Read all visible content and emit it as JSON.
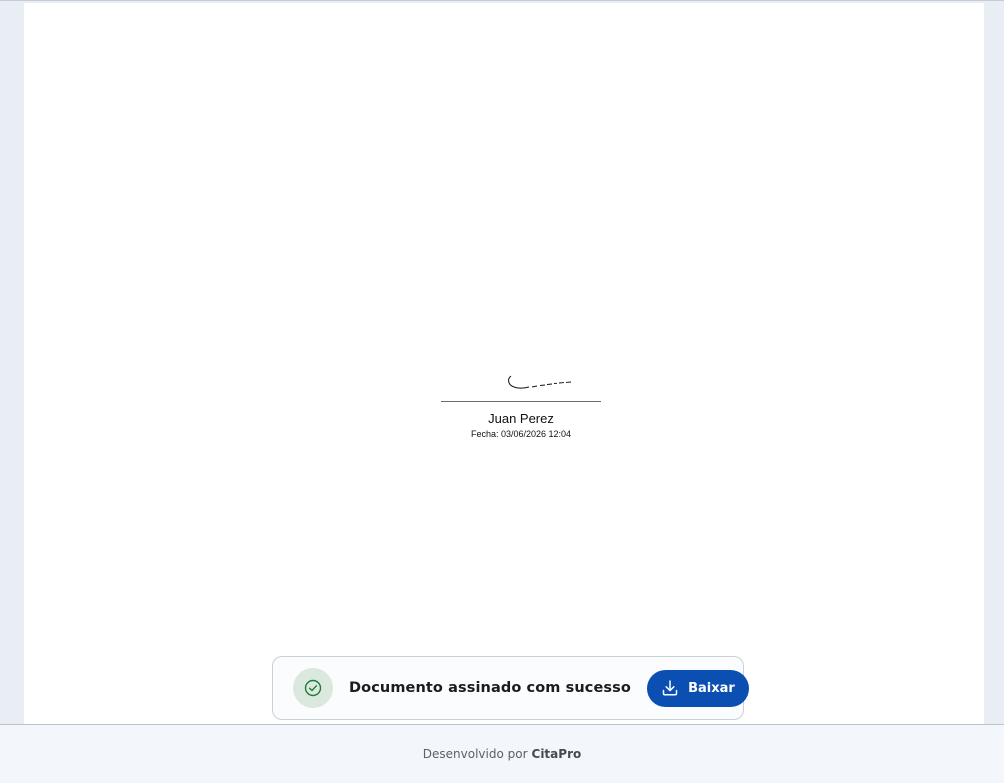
{
  "document": {
    "signature": {
      "image_kind": "handwritten-signature",
      "signer_name": "Juan Perez",
      "date_line": "Fecha: 03/06/2026 12:04"
    }
  },
  "toast": {
    "icon": "check-circle-icon",
    "message": "Documento assinado com sucesso",
    "download_button": {
      "icon": "download-icon",
      "label": "Baixar"
    },
    "colors": {
      "success_icon": "#1f7a3a",
      "success_bg": "#dbe8de",
      "button_bg": "#0b4fb3"
    }
  },
  "footer": {
    "prefix": "Desenvolvido por",
    "brand": "CitaPro"
  }
}
